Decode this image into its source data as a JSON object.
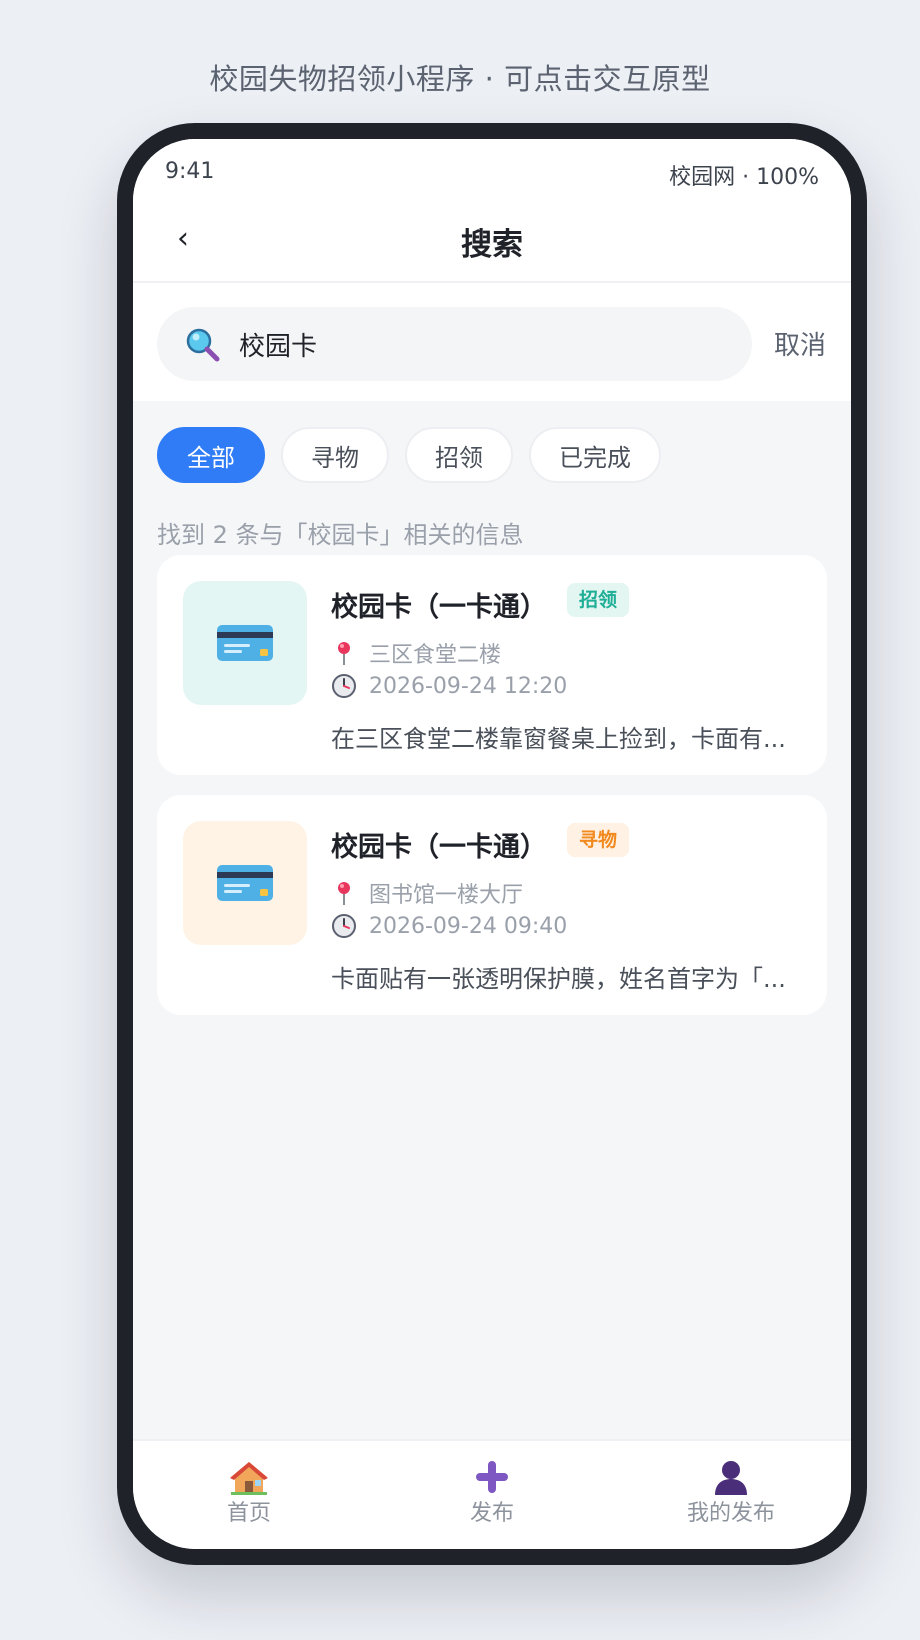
{
  "caption": "校园失物招领小程序 · 可点击交互原型",
  "status": {
    "time": "9:41",
    "right": "校园网 · 100%"
  },
  "nav": {
    "back": "‹",
    "title": "搜索"
  },
  "search": {
    "value": "校园卡",
    "cancel": "取消",
    "icon": "magnifier-icon"
  },
  "filters": [
    {
      "label": "全部",
      "active": true
    },
    {
      "label": "寻物",
      "active": false
    },
    {
      "label": "招领",
      "active": false
    },
    {
      "label": "已完成",
      "active": false
    }
  ],
  "result_hint": "找到 2 条与「校园卡」相关的信息",
  "items": [
    {
      "title": "校园卡（一卡通）",
      "tag": "招领",
      "location": "三区食堂二楼",
      "time": "2026-09-24 12:20",
      "desc": "在三区食堂二楼靠窗餐桌上捡到，卡面有...",
      "thumb_color": "#e4f6f3",
      "icon": "credit-card-icon"
    },
    {
      "title": "校园卡（一卡通）",
      "tag": "寻物",
      "location": "图书馆一楼大厅",
      "time": "2026-09-24 09:40",
      "desc": "卡面贴有一张透明保护膜，姓名首字为「...",
      "thumb_color": "#fff3e6",
      "icon": "credit-card-icon"
    }
  ],
  "tabbar": [
    {
      "label": "首页",
      "icon": "house-icon"
    },
    {
      "label": "发布",
      "icon": "plus-icon"
    },
    {
      "label": "我的发布",
      "icon": "user-icon"
    }
  ],
  "colors": {
    "accent": "#2f7cf6",
    "claim_tag": "#1fae96",
    "seek_tag": "#f28a1f"
  }
}
